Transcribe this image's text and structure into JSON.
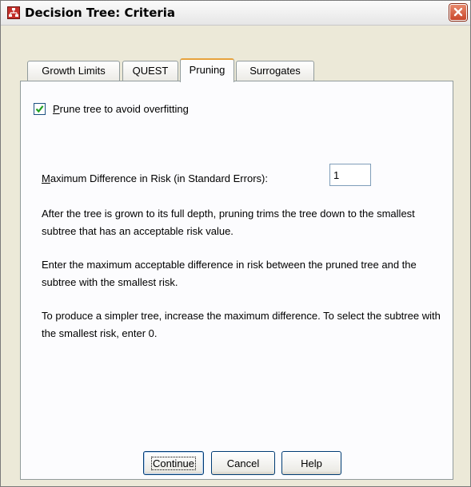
{
  "window": {
    "title": "Decision Tree: Criteria",
    "app_icon": "decision-tree-icon",
    "close_icon": "close-icon"
  },
  "tabs": [
    {
      "label": "Growth Limits",
      "active": false
    },
    {
      "label": "QUEST",
      "active": false
    },
    {
      "label": "Pruning",
      "active": true
    },
    {
      "label": "Surrogates",
      "active": false
    }
  ],
  "pruning": {
    "prune_checkbox": {
      "checked": true,
      "label_mnemonic": "P",
      "label_rest": "rune tree to avoid overfitting"
    },
    "max_diff": {
      "label_mnemonic": "M",
      "label_rest": "aximum Difference in Risk (in Standard Errors):",
      "value": "1"
    },
    "help_text": [
      "After the tree is grown to its full depth, pruning trims the tree down to the smallest subtree that has an acceptable risk value.",
      "Enter the maximum acceptable difference in risk between the pruned tree and the subtree with the smallest risk.",
      "To produce a simpler tree, increase the maximum difference. To select the subtree with the smallest risk, enter 0."
    ]
  },
  "buttons": {
    "continue": "Continue",
    "cancel": "Cancel",
    "help": "Help"
  },
  "colors": {
    "dialog_bg": "#ece9d8",
    "panel_bg": "#fcfcfe",
    "active_tab_accent": "#e7a23c",
    "close_button": "#c9472b"
  }
}
